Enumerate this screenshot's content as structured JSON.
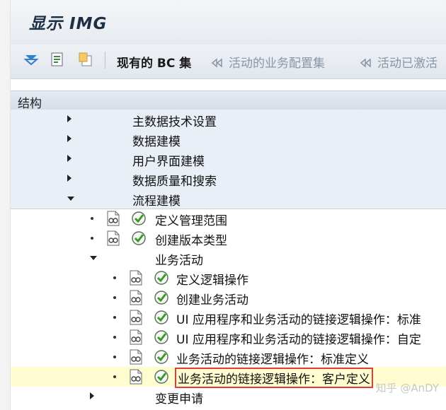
{
  "window": {
    "title": "显示 IMG"
  },
  "toolbar": {
    "items": [
      {
        "icon": "expand-tree-icon"
      },
      {
        "icon": "find-icon"
      },
      {
        "icon": "copy-icon"
      }
    ],
    "existing_bc_sets": "现有的 BC 集",
    "active_bc_sets": "活动的业务配置集",
    "activation_log": "活动已激活"
  },
  "structure": {
    "header": "结构"
  },
  "tree": {
    "items": [
      {
        "label": "主数据技术设置",
        "level": 1,
        "expander": "collapsed"
      },
      {
        "label": "数据建模",
        "level": 1,
        "expander": "collapsed"
      },
      {
        "label": "用户界面建模",
        "level": 1,
        "expander": "collapsed"
      },
      {
        "label": "数据质量和搜索",
        "level": 1,
        "expander": "collapsed"
      },
      {
        "label": "流程建模",
        "level": 1,
        "expander": "expanded"
      },
      {
        "label": "定义管理范围",
        "level": 2,
        "expander": "leaf"
      },
      {
        "label": "创建版本类型",
        "level": 2,
        "expander": "leaf"
      },
      {
        "label": "业务活动",
        "level": 2,
        "expander": "expanded"
      },
      {
        "label": "定义逻辑操作",
        "level": 3,
        "expander": "leaf"
      },
      {
        "label": "创建业务活动",
        "level": 3,
        "expander": "leaf"
      },
      {
        "label": "UI 应用程序和业务活动的链接逻辑操作：标准",
        "level": 3,
        "expander": "leaf"
      },
      {
        "label": "UI 应用程序和业务活动的链接逻辑操作：自定",
        "level": 3,
        "expander": "leaf"
      },
      {
        "label": "业务活动的链接逻辑操作：标准定义",
        "level": 3,
        "expander": "leaf"
      },
      {
        "label": "业务活动的链接逻辑操作：客户定义",
        "level": 3,
        "expander": "leaf",
        "selected": true
      },
      {
        "label": "变更申请",
        "level": 2,
        "expander": "collapsed"
      }
    ]
  },
  "watermark": "知乎 @AnDY",
  "colors": {
    "highlight": "#fffdcf",
    "selection_box": "#e23b3b",
    "header_bg": "#dbe2eb"
  }
}
